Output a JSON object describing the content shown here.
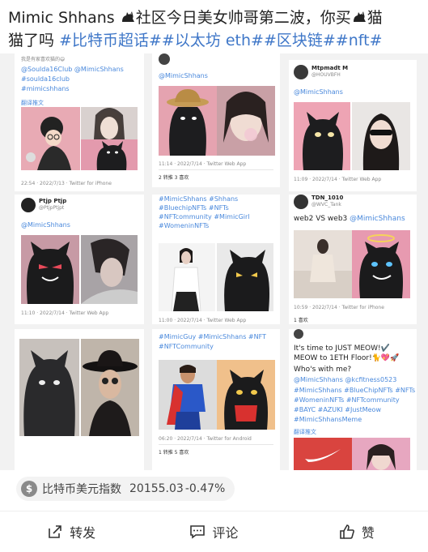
{
  "post": {
    "author": "Mimic Shhans",
    "text1": "社区今日美女帅哥第二波，你买",
    "text2": "猫",
    "text3": "猫了吗",
    "tags": "#比特币超话##以太坊 eth##区块链##nft#"
  },
  "tweets": {
    "c1": {
      "top_line": "我是有家喜欢猫的😄",
      "handles": [
        "@Soulda16Club @MimicShhans",
        "#soulda16club",
        "#mimicshhans"
      ],
      "translate": "翻译推文",
      "meta": "22:54 · 2022/7/13 · Twitter for iPhone"
    },
    "c2": {
      "handle": "@MimicShhans",
      "meta": "11:14 · 2022/7/14 · Twitter Web App",
      "stats": "2 转推  3 喜欢"
    },
    "c3": {
      "name": "Mtpmadt M",
      "sub": "@HOUVBFH",
      "handle": "@MimicShhans",
      "meta": "11:09 · 2022/7/14 · Twitter Web App"
    },
    "c4": {
      "name": "Ptjp Ptjp",
      "sub": "@PtjpPtjpt",
      "handle": "@MimicShhans",
      "meta": "11:10 · 2022/7/14 · Twitter Web App"
    },
    "c5": {
      "lines": [
        "#MimicShhans #Shhans",
        "#BluechipNFTs #NFTs",
        "#NFTcommunity #MimicGirl",
        "#WomeninNFTs"
      ],
      "meta": "11:00 · 2022/7/14 · Twitter Web App"
    },
    "c6": {
      "name": "TDN_1010",
      "sub": "@WVC_Tank",
      "body": "web2 VS web3 ",
      "handle": "@MimicShhans",
      "meta": "10:59 · 2022/7/14 · Twitter for iPhone",
      "stats": "1 喜欢"
    },
    "c7": {
      "lines": [
        "#MimicGuy #MimicShhans #NFT",
        "#NFTCommunity"
      ],
      "meta": "06:20 · 2022/7/14 · Twitter for Android",
      "stats": "1 转推  5 喜欢"
    },
    "c8": {
      "line1": "It's time to JUST MEOW!✔️",
      "line2": "MEOW to 1ETH Floor!🐈💖🚀",
      "line3": "Who's with me?",
      "line4": "@MimicShhans @kcfitness0523",
      "line5": "#MimicShhans #BlueChipNFTs #NFTs",
      "line6": "#WomeninNFTs #NFTcommunity",
      "line7": "#BAYC #AZUKI #JustMeow",
      "line8": "#MimicShhansMeme",
      "translate": "翻译推文"
    }
  },
  "index_bar": {
    "icon": "dollar-coin-icon",
    "name": "比特币美元指数",
    "value": "20155.03",
    "change": "-0.47%"
  },
  "actions": {
    "repost": "转发",
    "comment": "评论",
    "like": "赞"
  }
}
